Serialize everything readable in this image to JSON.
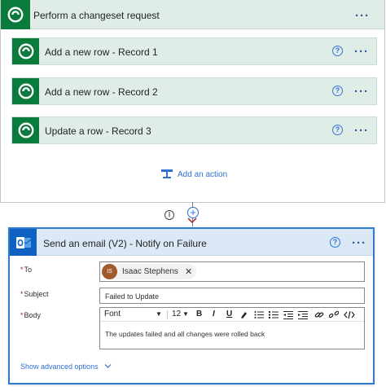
{
  "scope": {
    "title": "Perform a changeset request",
    "more_label": "···",
    "actions": [
      {
        "title": "Add a new row - Record 1",
        "help": "?",
        "more": "···"
      },
      {
        "title": "Add a new row - Record 2",
        "help": "?",
        "more": "···"
      },
      {
        "title": "Update a row - Record 3",
        "help": "?",
        "more": "···"
      }
    ],
    "add_action_label": "Add an action"
  },
  "connector": {
    "info_label": "i",
    "plus_label": "+"
  },
  "email": {
    "title": "Send an email (V2) - Notify on Failure",
    "help": "?",
    "more": "···",
    "to_label": "To",
    "to_recipient_initials": "IS",
    "to_recipient_name": "Isaac Stephens",
    "to_remove": "✕",
    "subject_label": "Subject",
    "subject_value": "Failed to Update",
    "body_label": "Body",
    "toolbar": {
      "font": "Font",
      "size": "12",
      "bold": "B",
      "italic": "I",
      "underline": "U"
    },
    "body_text": "The updates failed and all changes were rolled back",
    "advanced_label": "Show advanced options"
  },
  "icons": {
    "dataverse": "dataverse-icon",
    "outlook": "outlook-icon",
    "help": "help-circle-icon",
    "more": "more-ellipsis-icon",
    "add_action": "add-action-icon",
    "chevron": "chevron-down-icon"
  },
  "colors": {
    "dataverse_green": "#0b7a3d",
    "scope_header_bg": "#dfede6",
    "outlook_blue": "#0f62c2",
    "email_header_bg": "#dbe8f6",
    "link_blue": "#2e6fd0",
    "required_red": "#a4262c"
  }
}
